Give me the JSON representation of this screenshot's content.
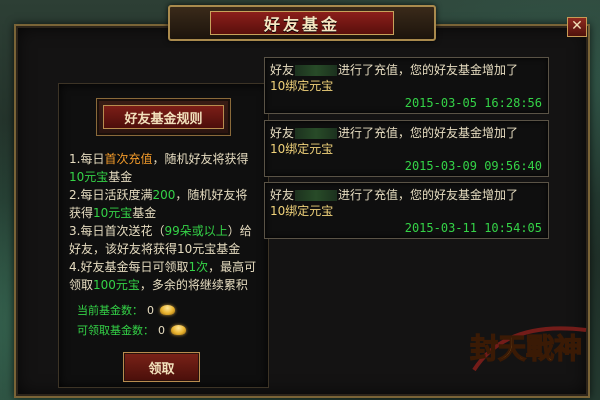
{
  "window": {
    "title": "好友基金",
    "close_label": "✕"
  },
  "rules_button": {
    "label": "好友基金规则"
  },
  "rules": [
    [
      {
        "t": "1.每日"
      },
      {
        "t": "首次充值",
        "c": "orange"
      },
      {
        "t": "，随机好友将获得"
      }
    ],
    [
      {
        "t": "10元宝",
        "c": "green"
      },
      {
        "t": "基金"
      }
    ],
    [
      {
        "t": "2.每日活跃度满"
      },
      {
        "t": "200",
        "c": "green"
      },
      {
        "t": "，随机好友将"
      }
    ],
    [
      {
        "t": "获得"
      },
      {
        "t": "10元宝",
        "c": "green"
      },
      {
        "t": "基金"
      }
    ],
    [
      {
        "t": "3.每日首次送花（"
      },
      {
        "t": "99朵或以上",
        "c": "green"
      },
      {
        "t": "）给"
      }
    ],
    [
      {
        "t": "好友，该好友将获得10元宝基金"
      }
    ],
    [
      {
        "t": "4.好友基金每日可领取"
      },
      {
        "t": "1次",
        "c": "green"
      },
      {
        "t": "，最高可"
      }
    ],
    [
      {
        "t": "领取"
      },
      {
        "t": "100元宝",
        "c": "green"
      },
      {
        "t": "，多余的将继续累积"
      }
    ]
  ],
  "fund": {
    "current_label": "当前基金数：",
    "current_value": "0",
    "claimable_label": "可领取基金数：",
    "claimable_value": "0"
  },
  "claim_button": {
    "label": "领取"
  },
  "records": [
    {
      "prefix": "好友",
      "text": "进行了充值，您的好友基金增加了",
      "amount": "10绑定元宝",
      "time": "2015-03-05 16:28:56"
    },
    {
      "prefix": "好友",
      "text": "进行了充值，您的好友基金增加了",
      "amount": "10绑定元宝",
      "time": "2015-03-09 09:56:40"
    },
    {
      "prefix": "好友",
      "text": "进行了充值，您的好友基金增加了",
      "amount": "10绑定元宝",
      "time": "2015-03-11 10:54:05"
    }
  ],
  "logo": {
    "text": "封天戰神"
  },
  "colors": {
    "highlight_orange": "#f19a2a",
    "highlight_green": "#34d347",
    "title_red": "#8b1f1b",
    "frame_gold": "#a98a4d"
  }
}
